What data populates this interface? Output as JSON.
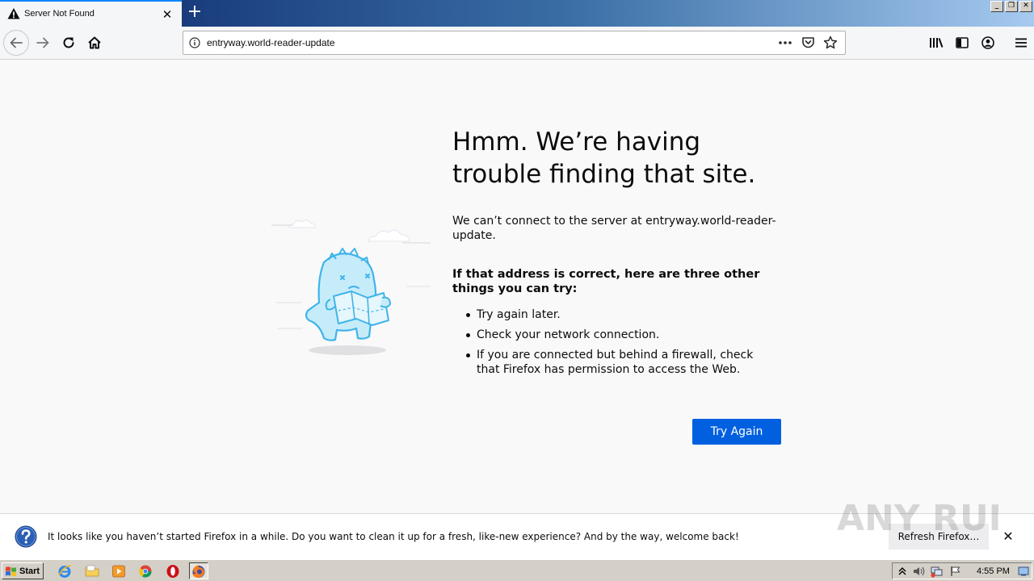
{
  "tab": {
    "title": "Server Not Found",
    "close": "✕"
  },
  "newtab": "+",
  "window": {
    "minimize": "_",
    "restore": "❐",
    "close": "✕"
  },
  "urlbar": {
    "url": "entryway.world-reader-update"
  },
  "page": {
    "title": "Hmm. We’re having trouble finding that site.",
    "description": "We can’t connect to the server at entryway.world-reader-update.",
    "suggestions_header": "If that address is correct, here are three other things you can try:",
    "suggestions": [
      "Try again later.",
      "Check your network connection.",
      "If you are connected but behind a firewall, check that Firefox has permission to access the Web."
    ],
    "try_again": "Try Again"
  },
  "notification": {
    "text": "It looks like you haven’t started Firefox in a while. Do you want to clean it up for a fresh, like-new experience? And by the way, welcome back!",
    "button": "Refresh Firefox…",
    "close": "✕"
  },
  "watermark": "ANY RUN",
  "taskbar": {
    "start": "Start",
    "clock": "4:55 PM"
  },
  "colors": {
    "accent": "#0060df",
    "link_blue": "#0a84ff",
    "page_bg": "#f9f9fa",
    "illustration": "#3fb4e9"
  }
}
